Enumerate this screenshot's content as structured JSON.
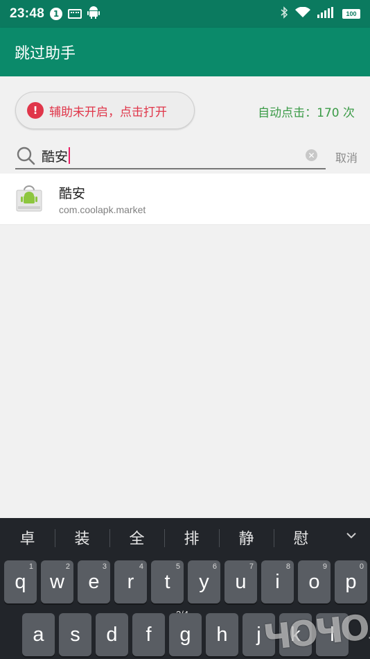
{
  "status_bar": {
    "time": "23:48",
    "notification_count": "1",
    "battery": "100",
    "icons": [
      "keyboard-icon",
      "android-icon",
      "bluetooth-icon",
      "wifi-icon",
      "signal-icon",
      "battery-icon"
    ]
  },
  "app_bar": {
    "title": "跳过助手"
  },
  "banner": {
    "accessibility_label": "辅助未开启，点击打开",
    "click_count": "自动点击：170 次",
    "warn_color": "#e0364a",
    "count_color": "#3b9b47"
  },
  "search": {
    "value": "酷安",
    "cancel_label": "取消"
  },
  "results": [
    {
      "name": "酷安",
      "package": "com.coolapk.market"
    }
  ],
  "keyboard": {
    "candidates": [
      "卓",
      "装",
      "全",
      "排",
      "静",
      "慰"
    ],
    "row1": [
      {
        "key": "q",
        "hint": "1"
      },
      {
        "key": "w",
        "hint": "2"
      },
      {
        "key": "e",
        "hint": "3"
      },
      {
        "key": "r",
        "hint": "4"
      },
      {
        "key": "t",
        "hint": "5"
      },
      {
        "key": "y",
        "hint": "6"
      },
      {
        "key": "u",
        "hint": "7"
      },
      {
        "key": "i",
        "hint": "8"
      },
      {
        "key": "o",
        "hint": "9"
      },
      {
        "key": "p",
        "hint": "0"
      }
    ],
    "row2": [
      "a",
      "s",
      "d",
      "f",
      "g",
      "h",
      "j",
      "k",
      "l"
    ],
    "page_indicator": "3/4"
  },
  "colors": {
    "primary": "#0b8a6a",
    "status_bar": "#0b7a5f",
    "caret": "#e91e63"
  }
}
